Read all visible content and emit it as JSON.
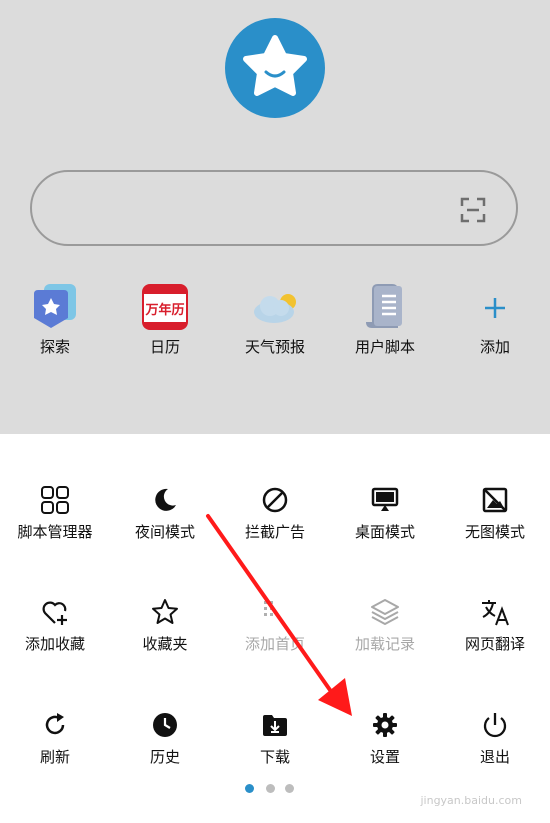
{
  "colors": {
    "accent": "#2a8fc9",
    "top_bg": "#dcdcdc",
    "arrow": "#ff1a1a",
    "disabled": "#a8a8a8"
  },
  "search": {
    "placeholder": "",
    "scan_icon": "scan-icon"
  },
  "shortcuts": [
    {
      "label": "探索",
      "icon": "explore-icon"
    },
    {
      "label": "日历",
      "icon": "calendar-icon",
      "badge": "万年历"
    },
    {
      "label": "天气预报",
      "icon": "weather-icon"
    },
    {
      "label": "用户脚本",
      "icon": "script-icon"
    },
    {
      "label": "添加",
      "icon": "plus-icon"
    }
  ],
  "menu": {
    "rows": [
      [
        {
          "label": "脚本管理器",
          "icon": "grid-icon"
        },
        {
          "label": "夜间模式",
          "icon": "moon-icon"
        },
        {
          "label": "拦截广告",
          "icon": "block-icon"
        },
        {
          "label": "桌面模式",
          "icon": "monitor-icon"
        },
        {
          "label": "无图模式",
          "icon": "no-image-icon"
        }
      ],
      [
        {
          "label": "添加收藏",
          "icon": "heart-plus-icon"
        },
        {
          "label": "收藏夹",
          "icon": "star-icon"
        },
        {
          "label": "添加首页",
          "icon": "add-home-icon",
          "disabled": true
        },
        {
          "label": "加载记录",
          "icon": "layers-icon",
          "disabled": true
        },
        {
          "label": "网页翻译",
          "icon": "translate-icon"
        }
      ],
      [
        {
          "label": "刷新",
          "icon": "refresh-icon"
        },
        {
          "label": "历史",
          "icon": "clock-icon"
        },
        {
          "label": "下载",
          "icon": "download-folder-icon"
        },
        {
          "label": "设置",
          "icon": "gear-icon"
        },
        {
          "label": "退出",
          "icon": "power-icon"
        }
      ]
    ]
  },
  "pager": {
    "pages": 3,
    "current": 1
  },
  "watermark": "jingyan.baidu.com"
}
